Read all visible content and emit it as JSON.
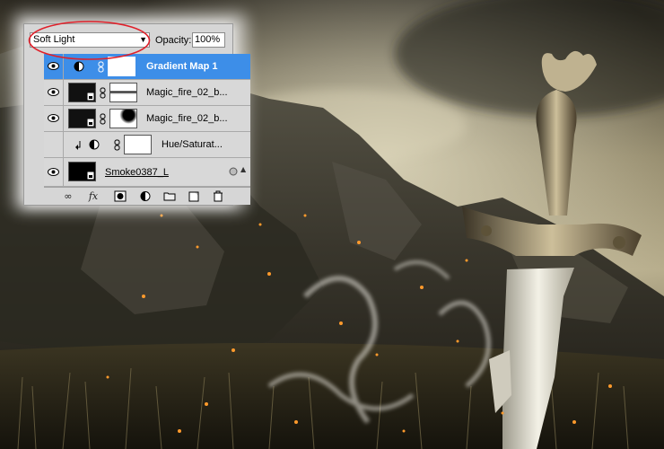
{
  "layers_panel": {
    "blend_mode": "Soft Light",
    "opacity_label": "Opacity:",
    "opacity_value": "100%",
    "layers": [
      {
        "name": "Gradient Map 1",
        "type": "adjustment",
        "selected": true,
        "visible": true
      },
      {
        "name": "Magic_fire_02_b...",
        "type": "smart-object",
        "selected": false,
        "visible": true
      },
      {
        "name": "Magic_fire_02_b...",
        "type": "smart-object",
        "selected": false,
        "visible": true
      },
      {
        "name": "Hue/Saturat...",
        "type": "adjustment-clipped",
        "selected": false,
        "visible": false
      },
      {
        "name": "Smoke0387_L",
        "type": "smart-object",
        "selected": false,
        "visible": true
      }
    ],
    "bottom_tools": [
      "link-icon",
      "fx-icon",
      "mask-icon",
      "adjustment-icon",
      "folder-icon",
      "new-layer-icon",
      "trash-icon"
    ]
  },
  "colors": {
    "selection": "#3d8ee8",
    "annotation": "#e0202a",
    "panel_bg": "#d6d6d6"
  }
}
